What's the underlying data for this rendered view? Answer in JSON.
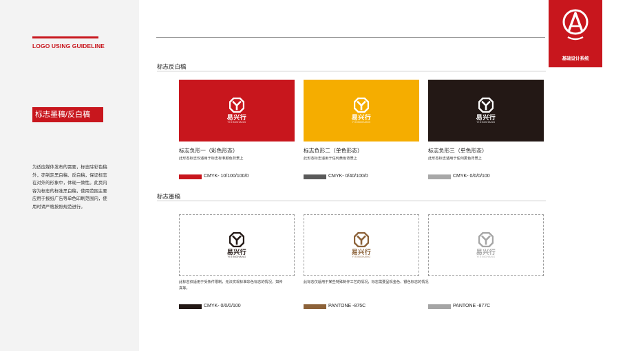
{
  "sidebar": {
    "guide_title": "LOGO USING GUIDELINE",
    "section_title": "标志墨稿/反白稿",
    "description": "为适应媒体发布的需要，标志除彩色稿外，亦制定黑白稿、反白稿，保证标志在对外的形象中，体现一致性。此页内容为标志的标准黑白稿，使用范围主要应用于报纸广告等单色印刷范围内，使用时请严格按照规范进行。"
  },
  "brand": {
    "label": "基础设计系统"
  },
  "logo": {
    "name": "易兴行",
    "pinyin": "YIXINGHANG"
  },
  "sections": {
    "reverse": "标志反白稿",
    "ink": "标志墨稿"
  },
  "reverse_cards": [
    {
      "title": "标志负形一（彩色形态）",
      "subtitle": "此形态标志仅适用于标志标准颜色背景上",
      "swatch_color": "#c8161d",
      "bg_color": "#c8161d",
      "swatch_label": "CMYK- 10/100/100/0"
    },
    {
      "title": "标志负形二（单色形态）",
      "subtitle": "此形态标志适用于任何黄色背景上",
      "swatch_color": "#5a5a5a",
      "bg_color": "#f5ad00",
      "swatch_label": "CMYK- 0/40/100/0"
    },
    {
      "title": "标志负形三（单色形态）",
      "subtitle": "此形态标志适用于任何黑色背景上",
      "swatch_color": "#a8a8a8",
      "bg_color": "#231815",
      "swatch_label": "CMYK- 0/0/0/100"
    }
  ],
  "ink_cards": [
    {
      "caption": "此标志仅适用于受条件限制，无法实现标准彩色标志的情况，如传真等。",
      "logo_color": "#231815",
      "swatch_color": "#231815",
      "swatch_label": "CMYK- 0/0/0/100"
    },
    {
      "caption": "此标志仅适用于某些特殊制作工艺的情况，标志需要呈现金色、银色标志的情况",
      "logo_color": "#8c6239",
      "swatch_color": "#8c6239",
      "swatch_label": "PANTONE -875C"
    },
    {
      "caption": "",
      "logo_color": "#a5a5a5",
      "swatch_color": "#a5a5a5",
      "swatch_label": "PANTONE -877C"
    }
  ]
}
